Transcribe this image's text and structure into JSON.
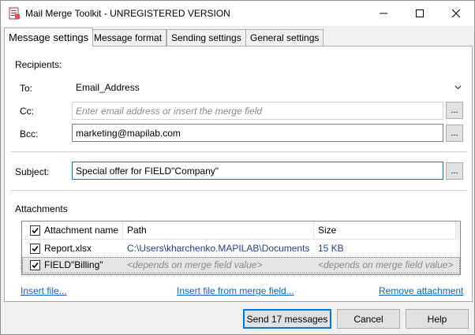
{
  "window": {
    "title": "Mail Merge Toolkit - UNREGISTERED VERSION",
    "app_icon": "mail-merge-icon",
    "controls": {
      "minimize": "minimize-icon",
      "maximize": "maximize-icon",
      "close": "close-icon"
    }
  },
  "tabs": [
    {
      "label": "Message settings",
      "active": true
    },
    {
      "label": "Message format",
      "active": false
    },
    {
      "label": "Sending settings",
      "active": false
    },
    {
      "label": "General settings",
      "active": false
    }
  ],
  "recipients": {
    "section_label": "Recipients:",
    "to_label": "To:",
    "to_value": "Email_Address",
    "cc_label": "Cc:",
    "cc_value": "",
    "cc_placeholder": "Enter email address or insert the merge field",
    "bcc_label": "Bcc:",
    "bcc_value": "marketing@mapilab.com",
    "browse_label": "..."
  },
  "subject": {
    "label": "Subject:",
    "value": "Special offer for FIELD\"Company\"",
    "browse_label": "..."
  },
  "attachments": {
    "section_label": "Attachments",
    "columns": {
      "name": "Attachment name",
      "path": "Path",
      "size": "Size"
    },
    "rows": [
      {
        "checked": true,
        "name": "Report.xlsx",
        "path": "C:\\Users\\kharchenko.MAPILAB\\Documents\\",
        "size": "15 KB"
      },
      {
        "checked": true,
        "name": "FIELD\"Billing\"",
        "path": "<depends on merge field value>",
        "size": "<depends on merge field value>"
      }
    ],
    "links": {
      "insert_file": "Insert file...",
      "insert_from_field": "Insert file from merge field...",
      "remove": "Remove attachment"
    }
  },
  "footer": {
    "send_label": "Send 17 messages",
    "cancel_label": "Cancel",
    "help_label": "Help"
  },
  "colors": {
    "link": "#0066cc",
    "focus": "#0078d7",
    "path_text": "#1f3f8f"
  }
}
